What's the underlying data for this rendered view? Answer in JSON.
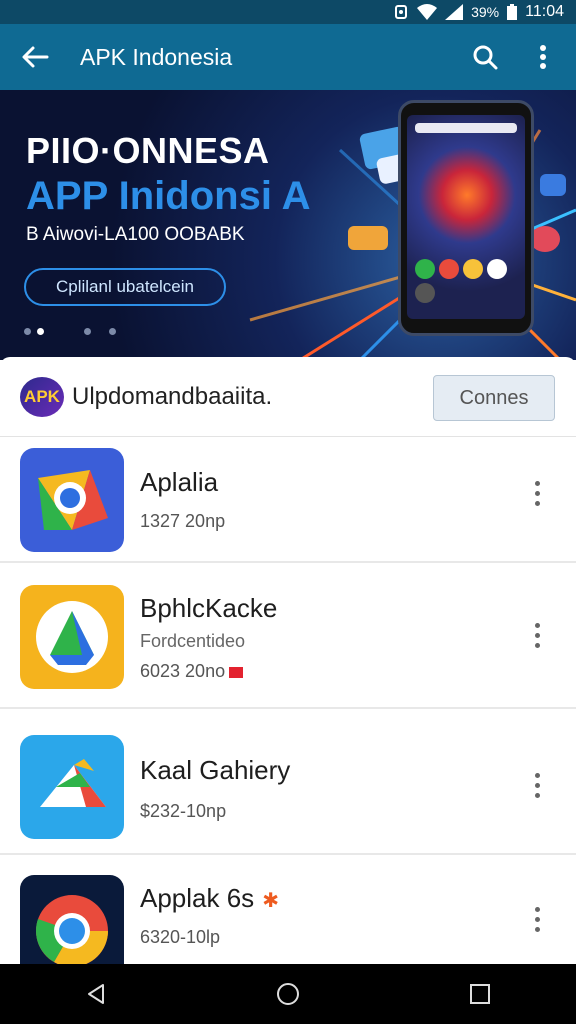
{
  "status_bar": {
    "battery": "39%",
    "time": "11:04",
    "icons": [
      "sync-icon",
      "wifi-icon",
      "signal-icon",
      "battery-icon"
    ]
  },
  "app_bar": {
    "title": "APK Indonesia",
    "icons": [
      "back-arrow-icon",
      "search-icon",
      "more-vert-icon"
    ]
  },
  "banner": {
    "line1": "PIIO·ONNESA",
    "line2": "APP Inidonsi A",
    "line3": "B Aiwovi-LA100 OOBABK",
    "cta": "Cplilanl ubatelcein",
    "slide_count": 4,
    "active_slide": 2
  },
  "card": {
    "logo_text": "APK",
    "title": "Ulpdomandbaaiita.",
    "button_label": "Connes"
  },
  "apps": [
    {
      "name": "Aplalia",
      "subtitle": "",
      "meta": "1327 20np",
      "badge": "",
      "icon": "chrome-triangle-icon"
    },
    {
      "name": "BphlcKacke",
      "subtitle": "Fordcentideo",
      "meta": "6023 20no",
      "badge": "flag",
      "icon": "drive-triangle-icon"
    },
    {
      "name": "Kaal  Gahiery",
      "subtitle": "",
      "meta": "$232-10np",
      "badge": "",
      "icon": "gallery-triangle-icon"
    },
    {
      "name": "Applak 6s",
      "subtitle": "",
      "meta": "6320-10lp",
      "badge": "star",
      "icon": "chrome-circle-icon"
    }
  ],
  "nav_bar": {
    "icons": [
      "nav-back-icon",
      "nav-home-icon",
      "nav-recents-icon"
    ]
  },
  "colors": {
    "status_bar": "#0d4966",
    "app_bar": "#0f6a93",
    "banner_accent": "#2d8fe8",
    "nav_bar": "#000000"
  }
}
